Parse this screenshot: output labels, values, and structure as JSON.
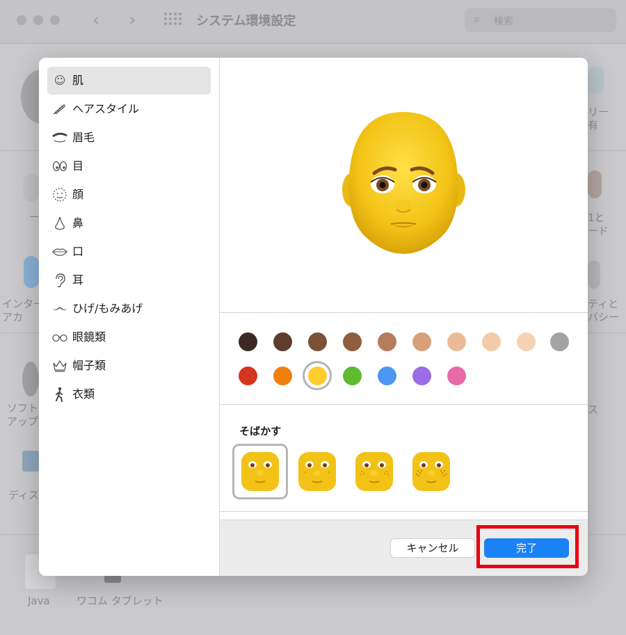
{
  "window": {
    "title": "システム環境設定",
    "search_placeholder": "検索",
    "bg_labels": [
      "リー\n有",
      "1と\nード",
      "インター\nアカ",
      "ティと\nバシー",
      "ソフト\nアップ",
      "ス",
      "ディス",
      "Java",
      "ワコム タブレット",
      "ー"
    ]
  },
  "sidebar": {
    "items": [
      {
        "icon": "smiley-icon",
        "label": "肌",
        "selected": true
      },
      {
        "icon": "comb-icon",
        "label": "ヘアスタイル"
      },
      {
        "icon": "eyebrow-icon",
        "label": "眉毛"
      },
      {
        "icon": "eyes-icon",
        "label": "目"
      },
      {
        "icon": "face-outline-icon",
        "label": "顔"
      },
      {
        "icon": "nose-icon",
        "label": "鼻"
      },
      {
        "icon": "mouth-icon",
        "label": "口"
      },
      {
        "icon": "ear-icon",
        "label": "耳"
      },
      {
        "icon": "mustache-icon",
        "label": "ひげ/もみあげ"
      },
      {
        "icon": "glasses-icon",
        "label": "眼鏡類"
      },
      {
        "icon": "crown-icon",
        "label": "帽子類"
      },
      {
        "icon": "person-walking-icon",
        "label": "衣類"
      }
    ]
  },
  "colors": {
    "row1": [
      "#3c2a22",
      "#5e3d2c",
      "#7b5038",
      "#8f5e3e",
      "#b57d5c",
      "#d7a07a",
      "#ebbb98",
      "#f3cba9",
      "#f5d2b4",
      "#a3a3a3"
    ],
    "row2": [
      "#d5341e",
      "#f17f0e",
      "#ffcc2e",
      "#5fba2f",
      "#4b96f2",
      "#9c6be8",
      "#e86aa6"
    ],
    "selected": "#ffcc2e",
    "accent": "#1b82f5"
  },
  "freckles": {
    "title": "そばかす",
    "options": [
      "freckles-none",
      "freckles-light",
      "freckles-medium",
      "freckles-heavy"
    ],
    "selected_index": 0
  },
  "footer": {
    "cancel_label": "キャンセル",
    "done_label": "完了"
  }
}
